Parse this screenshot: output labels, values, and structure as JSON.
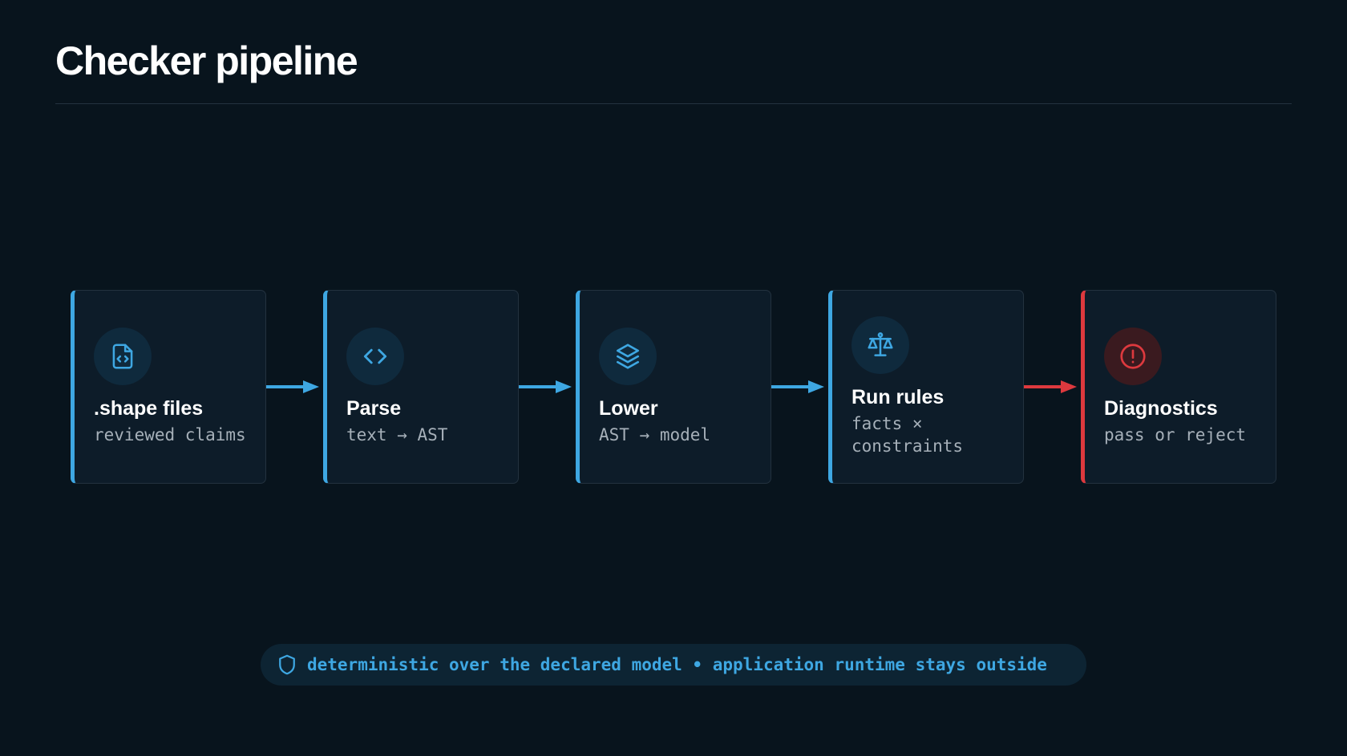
{
  "title": "Checker pipeline",
  "colors": {
    "background": "#08141d",
    "accent": "#3ea7e2",
    "error": "#dd393e"
  },
  "steps": [
    {
      "title": ".shape files",
      "subtitle": "reviewed claims",
      "icon": "file-code-icon",
      "status": "normal"
    },
    {
      "title": "Parse",
      "subtitle": "text → AST",
      "icon": "code-brackets-icon",
      "status": "normal"
    },
    {
      "title": "Lower",
      "subtitle": "AST → model",
      "icon": "layers-icon",
      "status": "normal"
    },
    {
      "title": "Run rules",
      "subtitle": "facts × constraints",
      "icon": "scale-icon",
      "status": "normal"
    },
    {
      "title": "Diagnostics",
      "subtitle": "pass or reject",
      "icon": "alert-circle-icon",
      "status": "error"
    }
  ],
  "footer": {
    "icon": "shield-icon",
    "text": "deterministic over the declared model • application runtime stays outside"
  }
}
